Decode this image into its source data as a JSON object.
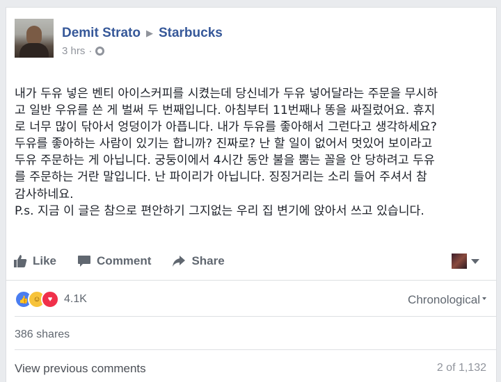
{
  "post": {
    "author": "Demit Strato",
    "page": "Starbucks",
    "time": "3 hrs",
    "separator": "·",
    "lines": [
      "내가 두유 넣은 벤티 아이스커피를 시켰는데 당신네가 두유 넣어달라는 주문을 무시하",
      "고 일반 우유를 쓴 게 벌써 두 번째입니다. 아침부터 11번째나 똥을 싸질렀어요. 휴지",
      "로 너무 많이 닦아서 엉덩이가 아픕니다. 내가 두유를 좋아해서 그런다고 생각하세요?",
      "두유를 좋아하는 사람이 있기는 합니까? 진짜로? 난 할 일이 없어서 멋있어 보이라고",
      "두유 주문하는 게 아닙니다. 궁둥이에서 4시간 동안 불을 뿜는 꼴을 안 당하려고 두유",
      "를 주문하는 거란 말입니다. 난 파이리가 아닙니다. 징징거리는 소리 들어 주셔서 참",
      "감사하네요.",
      "P.s. 지금 이 글은 참으로 편안하기 그지없는 우리 집 변기에 앉아서 쓰고 있습니다."
    ]
  },
  "actions": {
    "like": "Like",
    "comment": "Comment",
    "share": "Share"
  },
  "stats": {
    "reactions_count": "4.1K",
    "sort_label": "Chronological",
    "shares": "386 shares"
  },
  "comments": {
    "view_previous": "View previous comments",
    "pager": "2 of 1,132"
  },
  "colors": {
    "link": "#365899",
    "muted": "#90949c",
    "action": "#606770"
  },
  "icons": [
    "thumbs-up-icon",
    "comment-icon",
    "share-arrow-icon",
    "globe-icon",
    "like-reaction-icon",
    "haha-reaction-icon",
    "love-reaction-icon",
    "chevron-down-icon"
  ]
}
